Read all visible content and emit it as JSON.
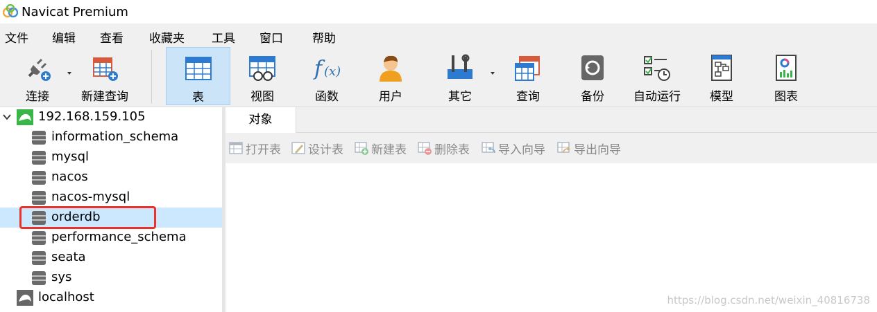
{
  "window": {
    "title": "Navicat Premium"
  },
  "menu": [
    "文件",
    "编辑",
    "查看",
    "收藏夹",
    "工具",
    "窗口",
    "帮助"
  ],
  "toolbar": {
    "connect": "连接",
    "new_query": "新建查询",
    "table": "表",
    "view": "视图",
    "function": "函数",
    "user": "用户",
    "other": "其它",
    "query": "查询",
    "backup": "备份",
    "automation": "自动运行",
    "model": "模型",
    "chart": "图表"
  },
  "tree": {
    "connection": "192.168.159.105",
    "databases": [
      "information_schema",
      "mysql",
      "nacos",
      "nacos-mysql",
      "orderdb",
      "performance_schema",
      "seata",
      "sys"
    ],
    "selected": "orderdb",
    "other_connection": "localhost"
  },
  "tabs": {
    "objects": "对象"
  },
  "object_toolbar": {
    "open_table": "打开表",
    "design_table": "设计表",
    "new_table": "新建表",
    "delete_table": "删除表",
    "import_wizard": "导入向导",
    "export_wizard": "导出向导"
  },
  "watermark": "https://blog.csdn.net/weixin_40816738",
  "colors": {
    "accent": "#cce4f7",
    "selected_row": "#cce8ff",
    "highlight_border": "#e8322b",
    "connection_green": "#3ab54a"
  }
}
